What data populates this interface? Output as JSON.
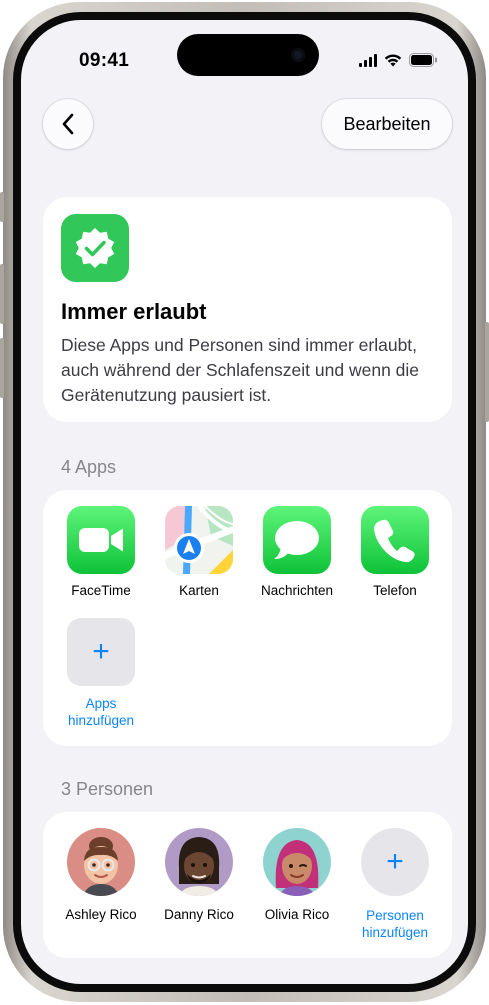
{
  "status_bar": {
    "time": "09:41"
  },
  "nav": {
    "edit_label": "Bearbeiten"
  },
  "info": {
    "title": "Immer erlaubt",
    "description": "Diese Apps und Personen sind immer erlaubt, auch während der Schlafenszeit und wenn die Gerätenutzung pausiert ist."
  },
  "apps_section": {
    "header": "4 Apps",
    "apps": [
      {
        "label": "FaceTime",
        "icon": "facetime-icon"
      },
      {
        "label": "Karten",
        "icon": "maps-icon"
      },
      {
        "label": "Nachrichten",
        "icon": "messages-icon"
      },
      {
        "label": "Telefon",
        "icon": "phone-icon"
      }
    ],
    "add_line1": "Apps",
    "add_line2": "hinzufügen"
  },
  "people_section": {
    "header": "3 Personen",
    "people": [
      {
        "label": "Ashley Rico"
      },
      {
        "label": "Danny Rico"
      },
      {
        "label": "Olivia Rico"
      }
    ],
    "add_line1": "Personen",
    "add_line2": "hinzufügen"
  },
  "colors": {
    "accent": "#0a84ff",
    "badge_green": "#31c759",
    "background": "#f2f2f7"
  }
}
